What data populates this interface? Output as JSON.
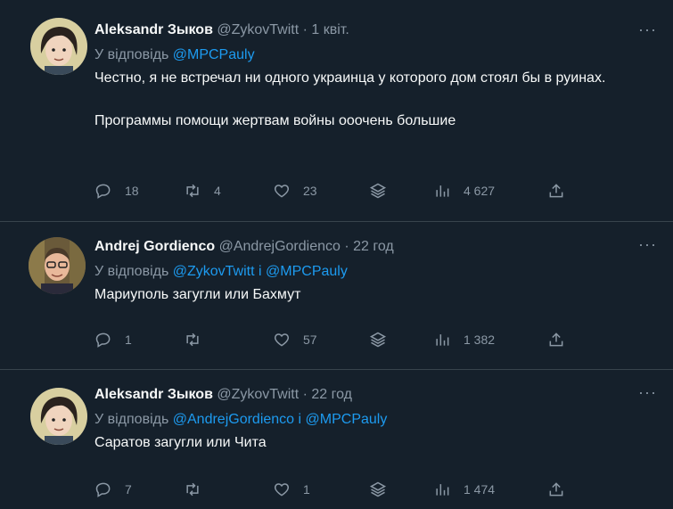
{
  "tweets": [
    {
      "name": "Aleksandr Зыков",
      "handle": "@ZykovTwitt",
      "dot": "·",
      "time": "1 квіт.",
      "reply_prefix": "У відповідь",
      "reply_to": "@MPCPauly",
      "text_line1": "Честно, я не встречал ни одного украинца у которого дом стоял бы в руинах.",
      "text_line2": "Программы помощи жертвам войны ооочень большие",
      "replies": "18",
      "retweets": "4",
      "likes": "23",
      "views": "4 627",
      "avatar": "avatar-long-hair"
    },
    {
      "name": "Andrej Gordienco",
      "handle": "@AndrejGordienco",
      "dot": "·",
      "time": "22 год",
      "reply_prefix": "У відповідь",
      "reply_to": "@ZykovTwitt",
      "reply_sep": "і",
      "reply_to2": "@MPCPauly",
      "text_line1": "Мариуполь загугли или Бахмут",
      "replies": "1",
      "retweets": "",
      "likes": "57",
      "views": "1 382",
      "avatar": "avatar-glasses"
    },
    {
      "name": "Aleksandr Зыков",
      "handle": "@ZykovTwitt",
      "dot": "·",
      "time": "22 год",
      "reply_prefix": "У відповідь",
      "reply_to": "@AndrejGordienco",
      "reply_sep": "і",
      "reply_to2": "@MPCPauly",
      "text_line1": "Саратов загугли или Чита",
      "replies": "7",
      "retweets": "",
      "likes": "1",
      "views": "1 474",
      "avatar": "avatar-long-hair"
    }
  ],
  "more_glyph": "···",
  "colors": {
    "background": "#15202b",
    "text": "#f7f9f9",
    "secondary": "#8b98a5",
    "link": "#1d9bf0",
    "divider": "#38444d"
  }
}
